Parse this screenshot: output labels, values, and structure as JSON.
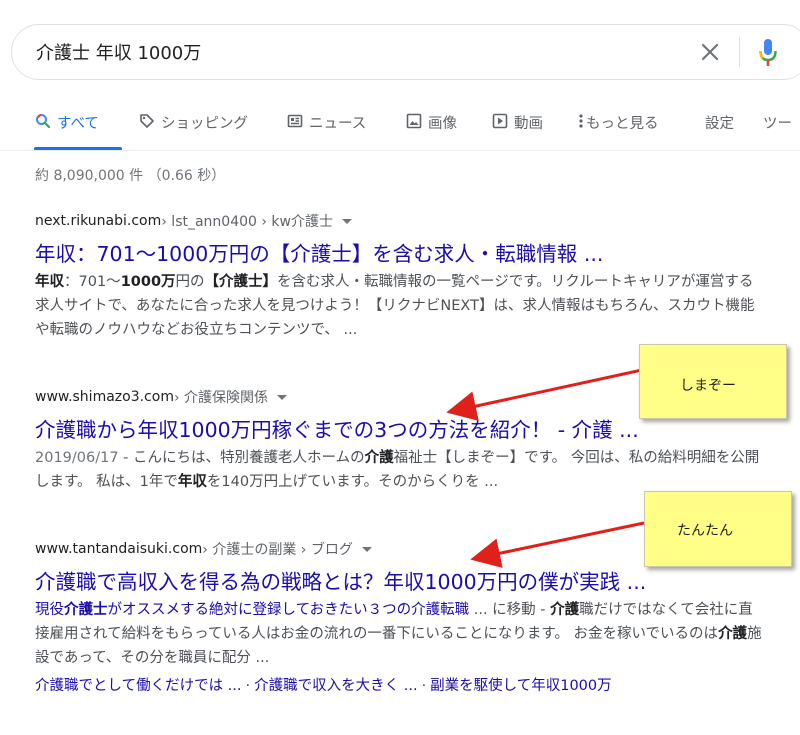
{
  "search": {
    "query": "介護士 年収 1000万"
  },
  "tabs": [
    {
      "label": "すべて",
      "icon": "search-icon"
    },
    {
      "label": "ショッピング",
      "icon": "tag-icon"
    },
    {
      "label": "ニュース",
      "icon": "news-icon"
    },
    {
      "label": "画像",
      "icon": "image-icon"
    },
    {
      "label": "動画",
      "icon": "video-icon"
    },
    {
      "label": "もっと見る",
      "icon": "more-vert-icon"
    },
    {
      "label": "設定"
    },
    {
      "label": "ツー"
    }
  ],
  "stats": "約 8,090,000 件 （0.66 秒）",
  "results": [
    {
      "site": "next.rikunabi.com",
      "path": " › lst_ann0400 › kw介護士",
      "title": "年収：701～1000万円の【介護士】を含む求人・転職情報 ...",
      "snippet": {
        "b1": "年収",
        "t1": "：701～",
        "b2": "1000万",
        "t2": "円の",
        "b3": "【介護士】",
        "t3": "を含む求人・転職情報の一覧ページです。リクルートキャリアが運営する求人サイトで、あなたに合った求人を見つけよう！【リクナビNEXT】は、求人情報はもちろん、スカウト機能や転職のノウハウなどお役立ちコンテンツで、 ..."
      }
    },
    {
      "site": "www.shimazo3.com",
      "path": " › 介護保険関係",
      "title": "介護職から年収1000万円稼ぐまでの3つの方法を紹介！ - 介護 ...",
      "snippet": {
        "date": "2019/06/17",
        "t1": " - こんにちは、特別養護老人ホームの",
        "b1": "介護",
        "t2": "福祉士【しまぞー】です。 今回は、私の給料明細を公開します。 私は、1年で",
        "b2": "年収",
        "t3": "を140万円上げています。そのからくりを ..."
      }
    },
    {
      "site": "www.tantandaisuki.com",
      "path": " › 介護士の副業 › ブログ",
      "title": "介護職で高収入を得る為の戦略とは？年収1000万円の僕が実践 ...",
      "snippet": {
        "l1": "現役",
        "b1": "介護士",
        "l2": "がオススメする絶対に登録しておきたい３つの介護転職",
        "t1": " ... に移動 - ",
        "b2": "介護",
        "t2": "職だけではなくて会社に直接雇用されて給料をもらっている人はお金の流れの一番下にいることになります。 お金を稼いでいるのは",
        "b3": "介護",
        "t3": "施設であって、その分を職員に配分 ..."
      },
      "sitelinks": [
        "介護職でとして働くだけでは ...",
        "介護職で収入を大きく ...",
        "副業を駆使して年収1000万"
      ]
    }
  ],
  "annotations": [
    {
      "label": "しまぞー",
      "color": "#ffff88",
      "arrow_color": "#e0201b"
    },
    {
      "label": "たんたん",
      "color": "#ffff88",
      "arrow_color": "#e0201b"
    }
  ],
  "colors": {
    "link": "#1a0dab",
    "accent": "#1a73e8",
    "text": "#4d5156"
  }
}
